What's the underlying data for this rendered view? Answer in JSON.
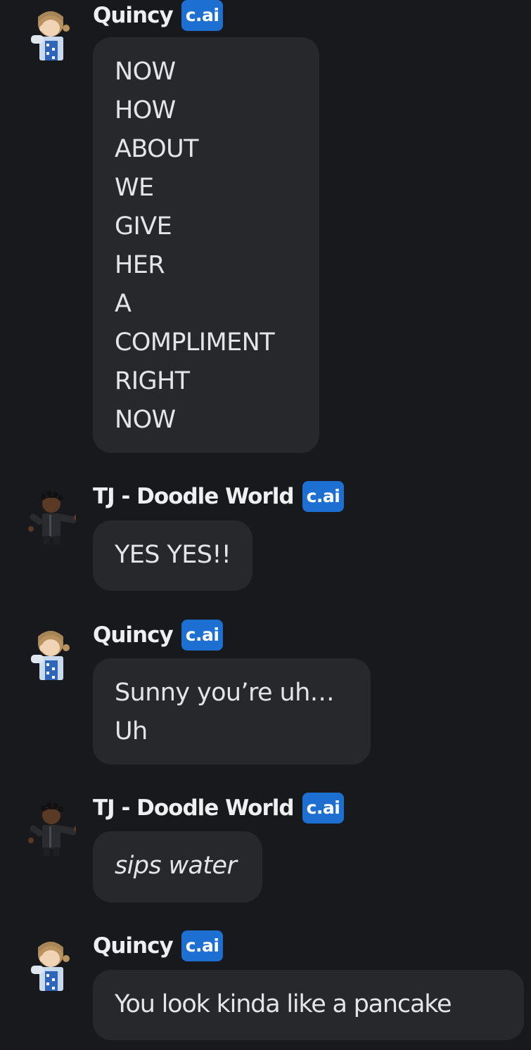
{
  "badge_label": "c.ai",
  "colors": {
    "background": "#18191c",
    "bubble": "#26282c",
    "badge": "#1d6fd1",
    "text": "#e4e5e8"
  },
  "messages": [
    {
      "author": "Quincy",
      "avatar_icon": "quincy-avatar-icon",
      "lines": [
        "NOW",
        "HOW",
        "ABOUT",
        "WE",
        "GIVE",
        "HER",
        "A",
        "COMPLIMENT",
        "RIGHT",
        "NOW"
      ]
    },
    {
      "author": "TJ - Doodle World",
      "avatar_icon": "tj-avatar-icon",
      "lines": [
        "YES YES!!"
      ]
    },
    {
      "author": "Quincy",
      "avatar_icon": "quincy-avatar-icon",
      "lines": [
        "Sunny you’re uh…",
        "Uh"
      ]
    },
    {
      "author": "TJ - Doodle World",
      "avatar_icon": "tj-avatar-icon",
      "lines": [
        "sips water"
      ],
      "italic": true
    },
    {
      "author": "Quincy",
      "avatar_icon": "quincy-avatar-icon",
      "lines": [
        "You look kinda like a pancake"
      ]
    }
  ]
}
